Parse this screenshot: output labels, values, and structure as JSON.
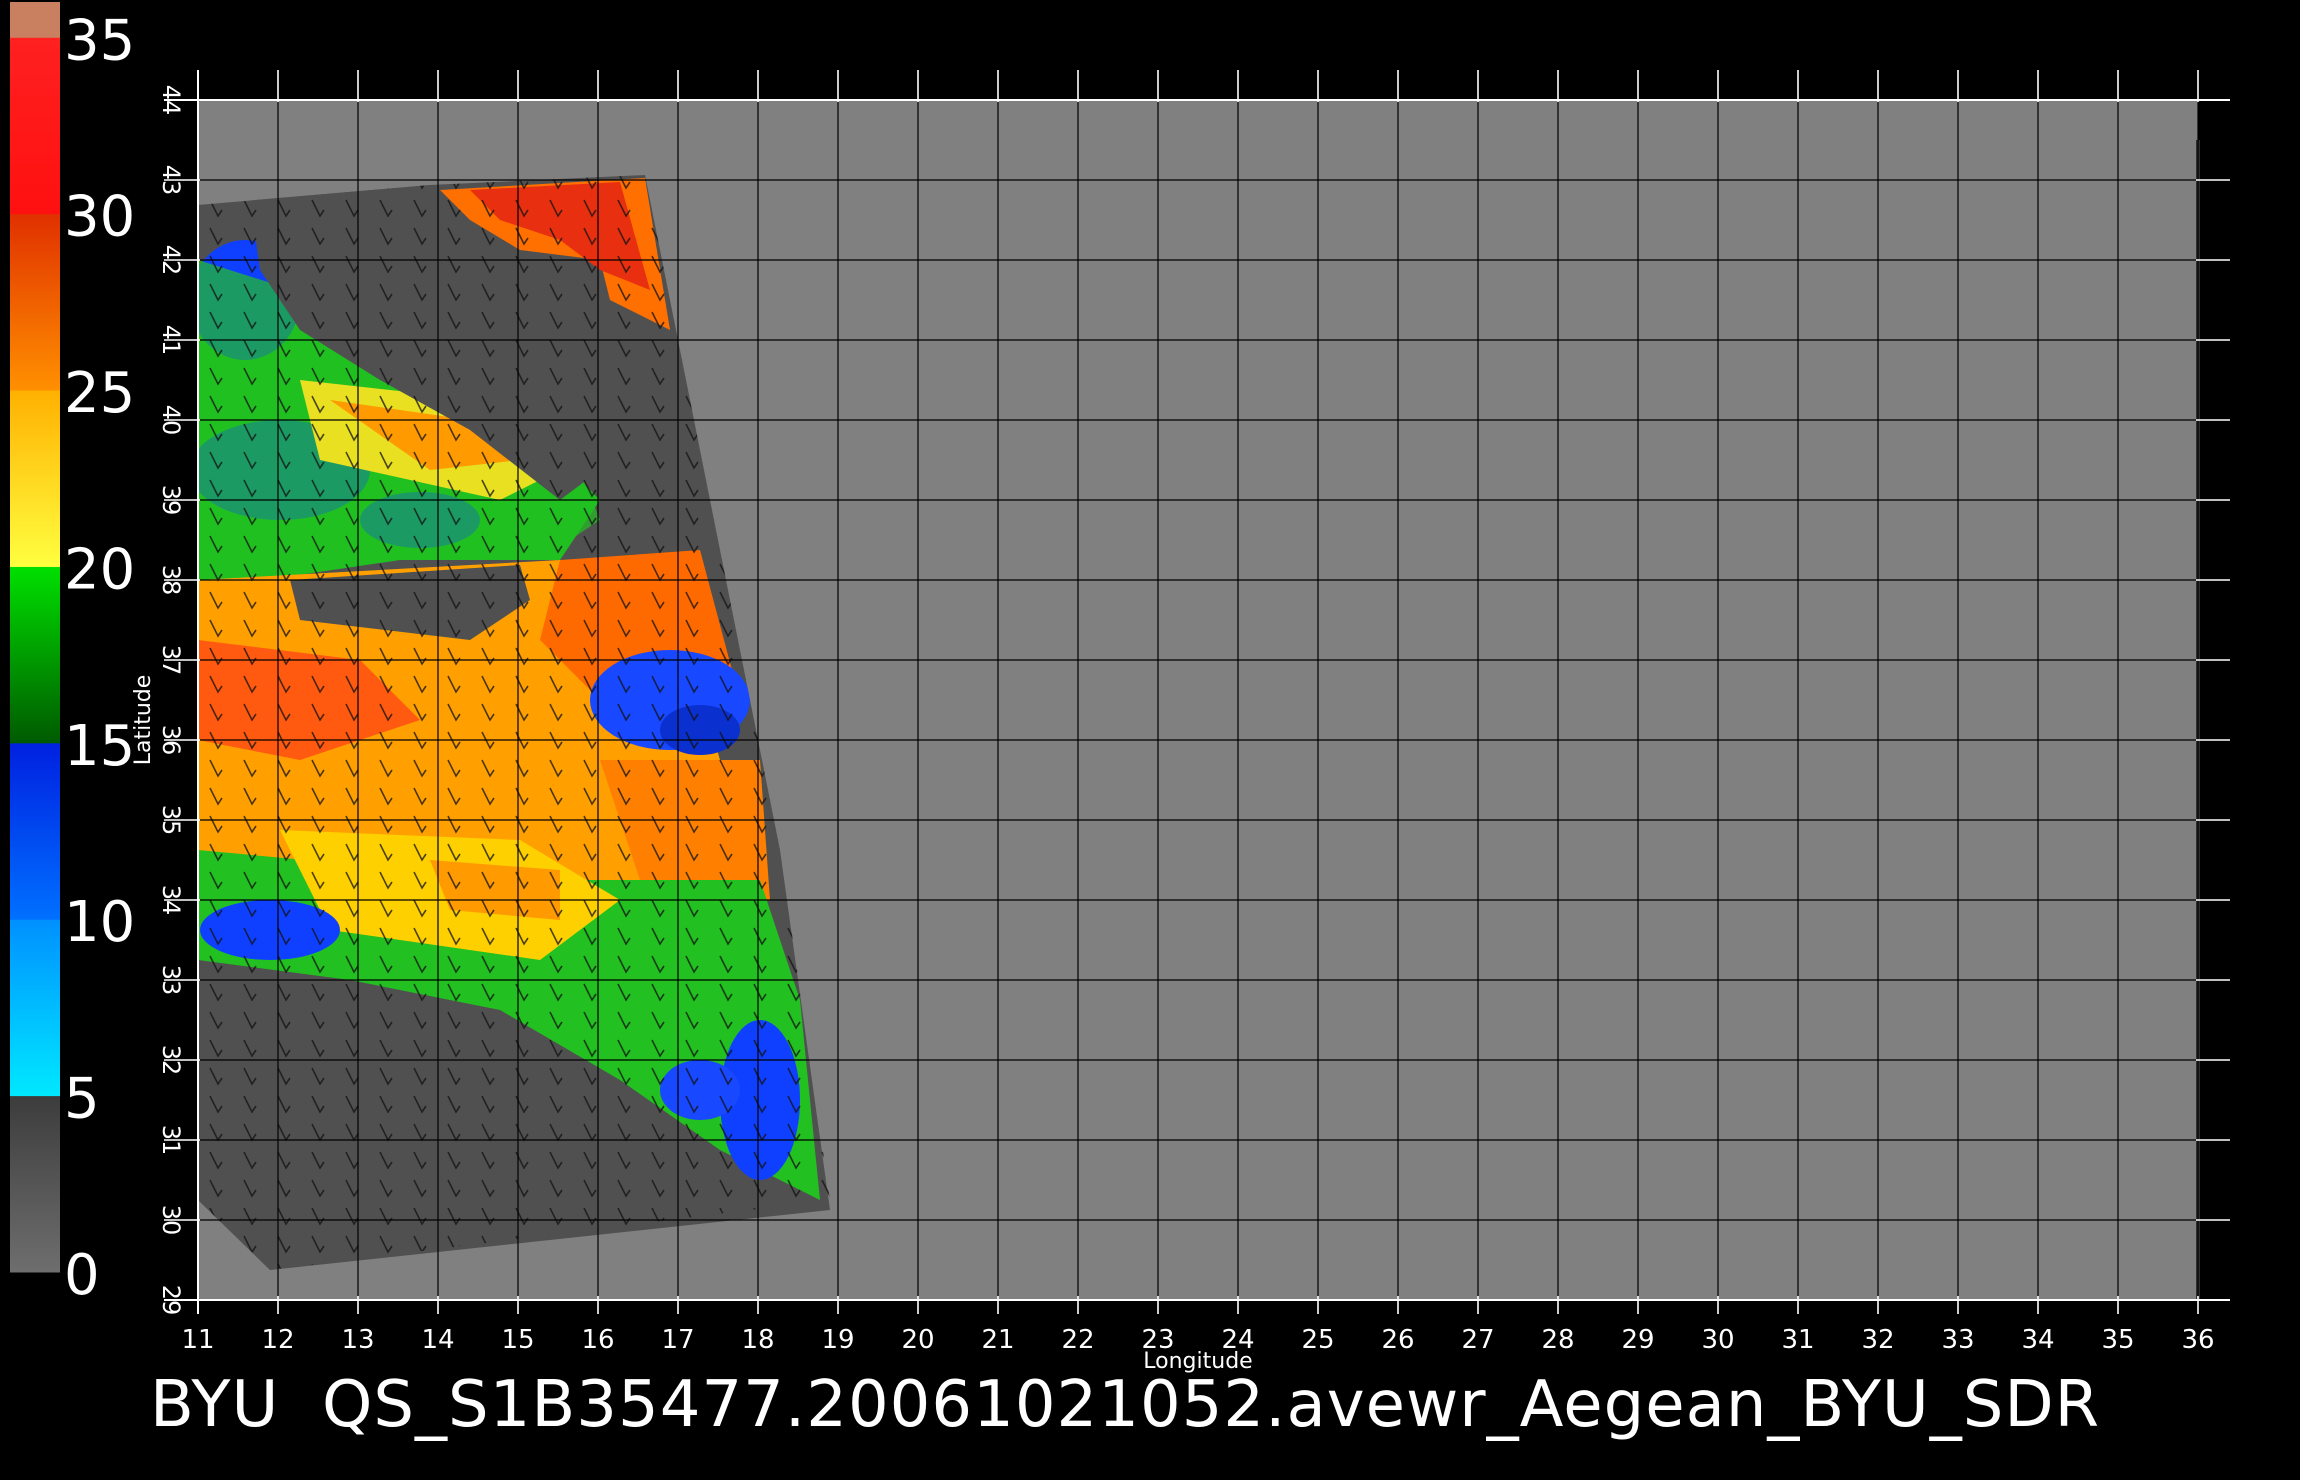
{
  "title": "BYU  QS_S1B35477.20061021052.avewr_Aegean_BYU_SDR",
  "map": {
    "xlabel": "Longitude",
    "ylabel": "Latitude",
    "xlim": [
      11,
      36
    ],
    "ylim": [
      29,
      44
    ],
    "x_ticks": [
      "11",
      "12",
      "13",
      "14",
      "15",
      "16",
      "17",
      "18",
      "19",
      "20",
      "21",
      "22",
      "23",
      "24",
      "25",
      "26",
      "27",
      "28",
      "29",
      "30",
      "31",
      "32",
      "33",
      "34",
      "35",
      "36"
    ],
    "y_ticks": [
      "29",
      "30",
      "31",
      "32",
      "33",
      "34",
      "35",
      "36",
      "37",
      "38",
      "39",
      "40",
      "41",
      "42",
      "43",
      "44"
    ],
    "grid": true,
    "background_color": "#808080",
    "swath_nodata_color": "#505050"
  },
  "colorbar": {
    "labels": [
      "0",
      "5",
      "10",
      "15",
      "20",
      "25",
      "30",
      "35"
    ],
    "values": [
      0,
      5,
      10,
      15,
      20,
      25,
      30,
      35
    ],
    "segments": [
      {
        "from": 0,
        "to": 5,
        "colors": [
          "#6e6e6e",
          "#3c3c3c"
        ]
      },
      {
        "from": 5,
        "to": 10,
        "colors": [
          "#00e8ff",
          "#0090ff"
        ]
      },
      {
        "from": 10,
        "to": 15,
        "colors": [
          "#0070ff",
          "#0020e0"
        ]
      },
      {
        "from": 15,
        "to": 20,
        "colors": [
          "#005a00",
          "#00e000"
        ]
      },
      {
        "from": 20,
        "to": 25,
        "colors": [
          "#ffff40",
          "#ffb000"
        ]
      },
      {
        "from": 25,
        "to": 30,
        "colors": [
          "#ff9000",
          "#e03000"
        ]
      },
      {
        "from": 30,
        "to": 35,
        "colors": [
          "#ff1010",
          "#ff2020"
        ]
      },
      {
        "from": 35,
        "to": 36,
        "colors": [
          "#c88060",
          "#c88060"
        ]
      }
    ]
  }
}
